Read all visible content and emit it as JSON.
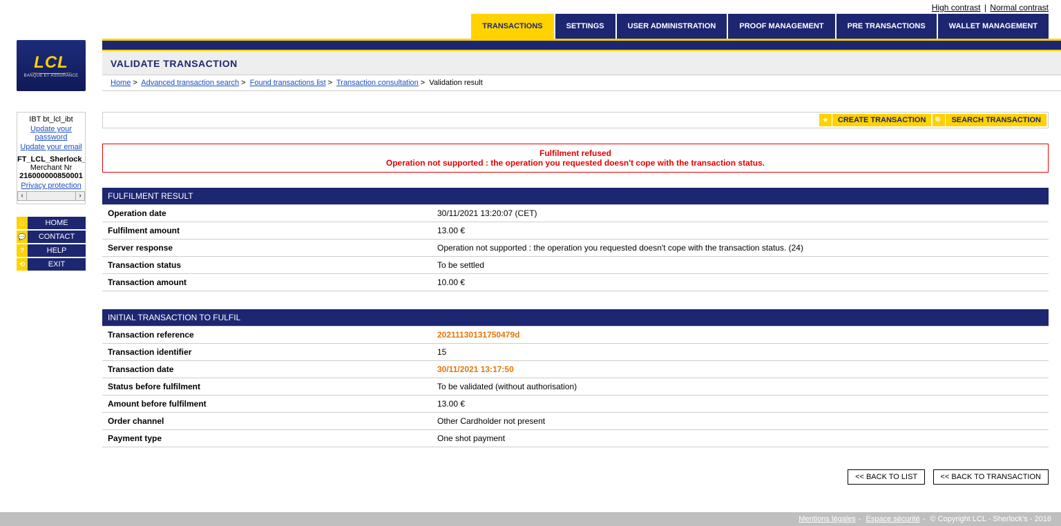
{
  "contrast": {
    "high": "High contrast",
    "normal": "Normal contrast"
  },
  "logo": {
    "main": "LCL",
    "sub": "BANQUE ET ASSURANCE"
  },
  "tabs": [
    {
      "label": "TRANSACTIONS",
      "active": true
    },
    {
      "label": "SETTINGS",
      "active": false
    },
    {
      "label": "USER ADMINISTRATION",
      "active": false
    },
    {
      "label": "PROOF MANAGEMENT",
      "active": false
    },
    {
      "label": "PRE TRANSACTIONS",
      "active": false
    },
    {
      "label": "WALLET MANAGEMENT",
      "active": false
    }
  ],
  "page_title": "VALIDATE TRANSACTION",
  "breadcrumb": {
    "home": "Home",
    "adv": "Advanced transaction search",
    "found": "Found transactions list",
    "consult": "Transaction consultation",
    "current": "Validation result"
  },
  "user_box": {
    "line1": "IBT bt_lcl_ibt",
    "update_pw": "Update your password",
    "update_email": "Update your email",
    "line4": "FT_LCL_Sherlock_",
    "line5": "Merchant Nr",
    "line6": "216000000850001",
    "privacy": "Privacy protection"
  },
  "nav": {
    "home": "HOME",
    "contact": "CONTACT",
    "help": "HELP",
    "exit": "EXIT"
  },
  "actions": {
    "create": "CREATE TRANSACTION",
    "search": "SEARCH TRANSACTION"
  },
  "alert": {
    "l1": "Fulfilment refused",
    "l2": "Operation not supported : the operation you requested doesn't cope with the transaction status."
  },
  "section1": {
    "title": "FULFILMENT RESULT",
    "rows": [
      {
        "k": "Operation date",
        "v": "30/11/2021 13:20:07 (CET)"
      },
      {
        "k": "Fulfilment amount",
        "v": "13.00  €"
      },
      {
        "k": "Server response",
        "v": "Operation not supported : the operation you requested doesn't cope with the transaction status. (24)"
      },
      {
        "k": "Transaction status",
        "v": "To be settled"
      },
      {
        "k": "Transaction amount",
        "v": "10.00  €"
      }
    ]
  },
  "section2": {
    "title": "INITIAL TRANSACTION TO FULFIL",
    "rows": [
      {
        "k": "Transaction reference",
        "v": "20211130131750479d",
        "orange": true
      },
      {
        "k": "Transaction identifier",
        "v": "15"
      },
      {
        "k": "Transaction date",
        "v": "30/11/2021 13:17:50",
        "orange": true
      },
      {
        "k": "Status before fulfilment",
        "v": "To be validated (without authorisation)"
      },
      {
        "k": "Amount before fulfilment",
        "v": "13.00  €"
      },
      {
        "k": "Order channel",
        "v": "Other Cardholder not present"
      },
      {
        "k": "Payment type",
        "v": "One shot payment"
      }
    ]
  },
  "buttons": {
    "back_list": "<< BACK TO LIST",
    "back_tx": "<< BACK TO TRANSACTION"
  },
  "footer": {
    "legal": "Mentions légales",
    "espace": "Espace sécurité",
    "copy": "© Copyright LCL - Sherlock's - 2016"
  }
}
